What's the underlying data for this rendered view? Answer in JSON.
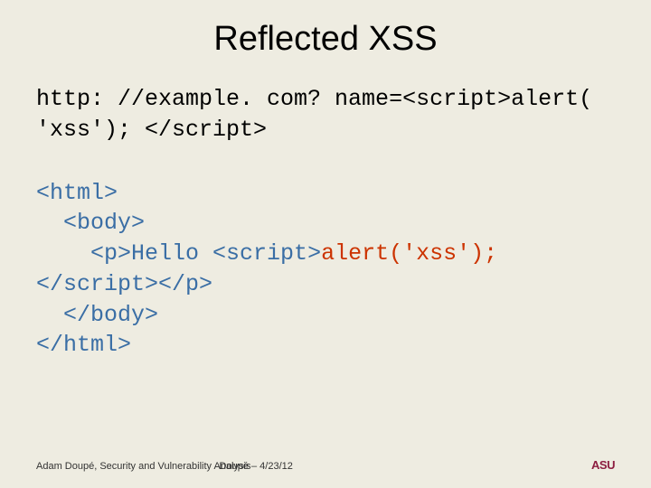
{
  "title": "Reflected XSS",
  "url_line1": "http: //example. com? name=<script>alert(",
  "url_line2": "'xss'); </script>",
  "h_open": "<html>",
  "b_open": "  <body>",
  "p_prefix": "    <p>Hello ",
  "script_open": "<script>",
  "alert_call": "alert('xss');",
  "script_close": "</script>",
  "p_close": "</p>",
  "b_close": "  </body>",
  "h_close": "</html>",
  "footer_author": "Adam Doupé, Security and Vulnerability Analysis",
  "footer_meta": "Doupé – 4/23/12",
  "logo": "ASU"
}
